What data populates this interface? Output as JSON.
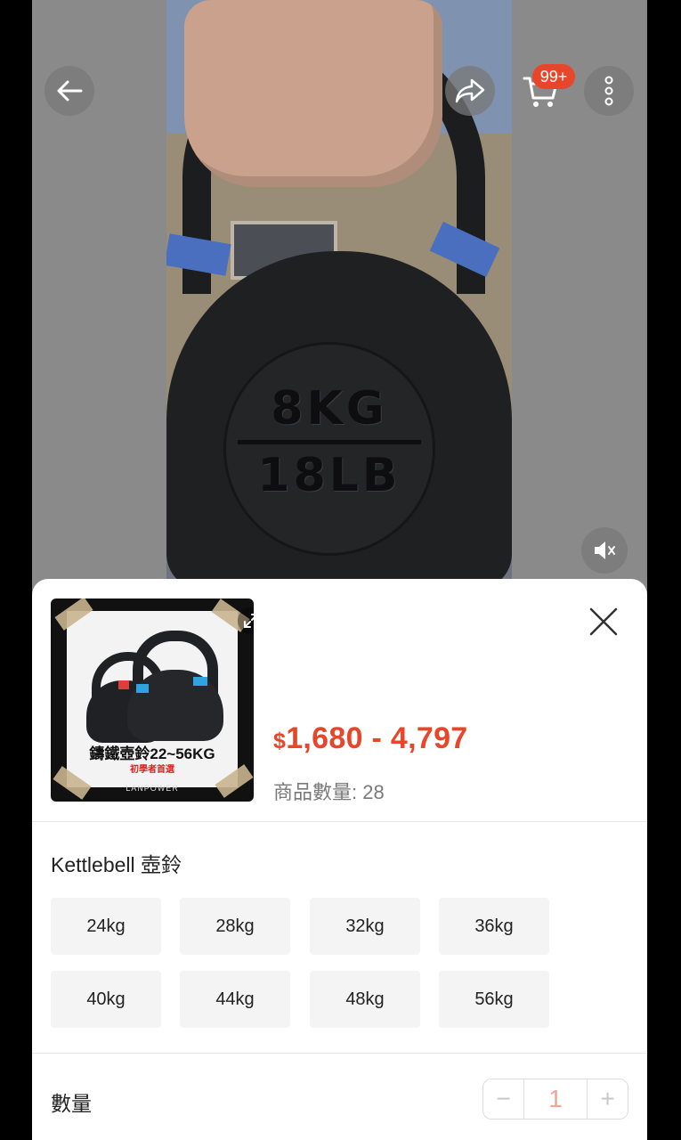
{
  "header": {
    "cart_badge": "99+"
  },
  "video": {
    "kettlebell_weight_kg": "8KG",
    "kettlebell_weight_lb": "18LB"
  },
  "product": {
    "thumb_title": "鑄鐵壺鈴22~56KG",
    "thumb_subtitle": "初學者首選",
    "thumb_brand": "LANPOWER",
    "price_currency": "$",
    "price_range": "1,680 - 4,797",
    "stock_label": "商品數量: 28"
  },
  "variants": {
    "title": "Kettlebell 壺鈴",
    "options": [
      "24kg",
      "28kg",
      "32kg",
      "36kg",
      "40kg",
      "44kg",
      "48kg",
      "56kg"
    ]
  },
  "quantity": {
    "label": "數量",
    "minus": "−",
    "value": "1",
    "plus": "+"
  },
  "colors": {
    "accent": "#e8462b"
  }
}
